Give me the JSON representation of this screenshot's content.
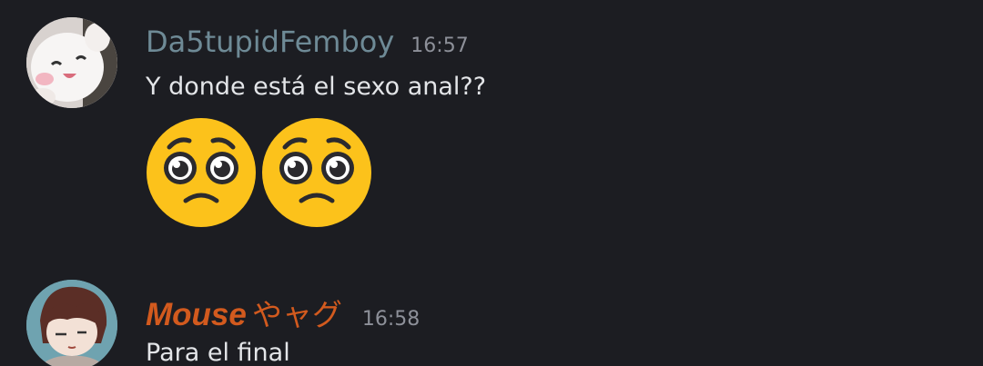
{
  "messages": [
    {
      "author": "Da5tupidFemboy",
      "time": "16:57",
      "text": "Y donde está el sexo anal??",
      "author_color": "#6e8a96",
      "avatar": "white-plush-bear-avatar",
      "emojis": [
        "pleading-face-emoji",
        "pleading-face-emoji"
      ]
    },
    {
      "author": "Mouse",
      "author_suffix": "やャグ",
      "time": "16:58",
      "text": "Para el final",
      "author_color": "#d25a1e",
      "avatar": "anime-character-avatar"
    }
  ]
}
